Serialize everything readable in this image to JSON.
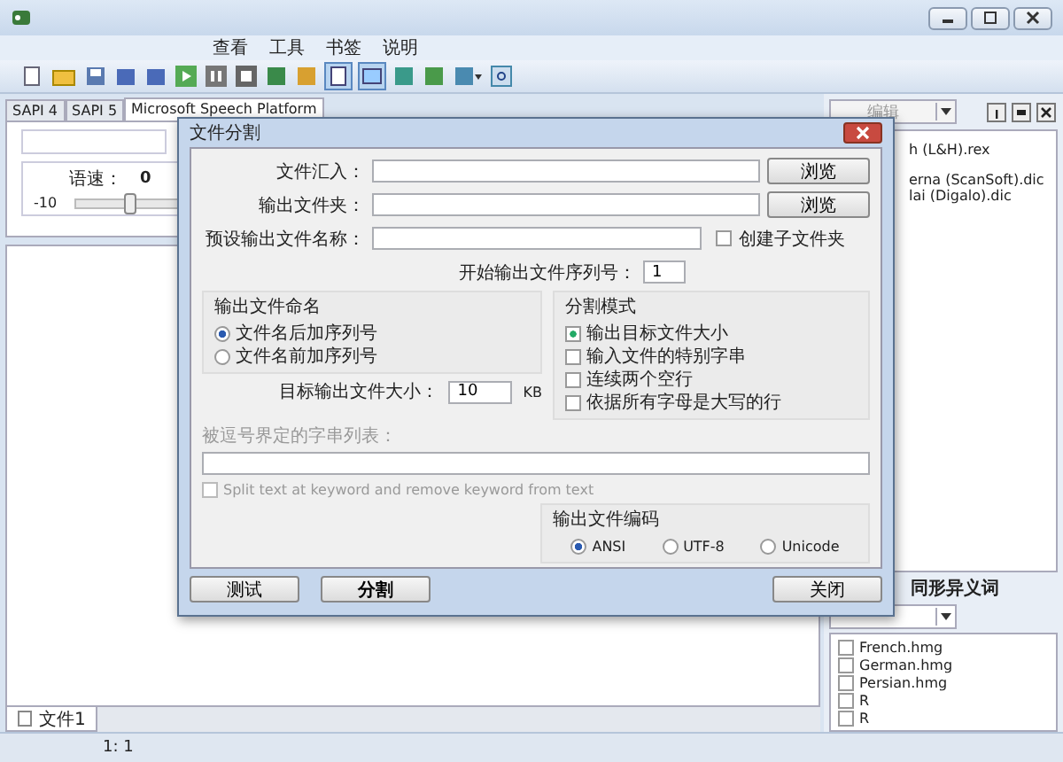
{
  "menu": [
    {
      "label": "查看"
    },
    {
      "label": "工具"
    },
    {
      "label": "书签"
    },
    {
      "label": "说明"
    }
  ],
  "voice_tabs": [
    {
      "label": "SAPI 4",
      "selected": false
    },
    {
      "label": "SAPI 5",
      "selected": false
    },
    {
      "label": "Microsoft Speech Platform",
      "selected": true
    }
  ],
  "rate": {
    "label": "语速：",
    "value": "0",
    "min": "-10",
    "level": 0.5
  },
  "document_tabs": [
    {
      "label": "文件1",
      "selected": true
    }
  ],
  "status_bar": {
    "position": "1:  1"
  },
  "right_panel": {
    "combo": "编辑",
    "dictionaries": [
      "h (L&H).rex",
      "erna (ScanSoft).dic",
      "lai (Digalo).dic"
    ],
    "homograph_title": "同形异义词",
    "homographs": [
      {
        "label": "French.hmg",
        "checked": false
      },
      {
        "label": "German.hmg",
        "checked": false
      },
      {
        "label": "Persian.hmg",
        "checked": false
      },
      {
        "label": "R",
        "checked": false
      },
      {
        "label": "R",
        "checked": false
      }
    ]
  },
  "dialog": {
    "title": "文件分割",
    "fields": [
      {
        "label": "文件汇入：",
        "button": "浏览"
      },
      {
        "label": "输出文件夹：",
        "button": "浏览"
      }
    ],
    "preset_name": {
      "label": "预设输出文件名称：",
      "checkbox": {
        "label": "创建子文件夹",
        "checked": false
      }
    },
    "start_number": {
      "label": "开始输出文件序列号：",
      "value": "1"
    },
    "naming": {
      "title": "输出文件命名",
      "options": [
        {
          "label": "文件名后加序列号",
          "selected": true
        },
        {
          "label": "文件名前加序列号",
          "selected": false
        }
      ]
    },
    "split_mode": {
      "title": "分割模式",
      "options": [
        {
          "label": "输出目标文件大小",
          "checked": true
        },
        {
          "label": "输入文件的特别字串",
          "checked": false
        },
        {
          "label": "连续两个空行",
          "checked": false
        },
        {
          "label": "依据所有字母是大写的行",
          "checked": false
        }
      ]
    },
    "target_size": {
      "label": "目标输出文件大小：",
      "value": "10",
      "unit": "KB"
    },
    "keywords": {
      "label": "被逗号界定的字串列表：",
      "disabled": true
    },
    "keyword_split": {
      "label": "Split text at keyword and remove keyword from text",
      "checked": false,
      "disabled": true
    },
    "encoding": {
      "title": "输出文件编码",
      "options": [
        {
          "label": "ANSI",
          "selected": true
        },
        {
          "label": "UTF-8",
          "selected": false
        },
        {
          "label": "Unicode",
          "selected": false
        }
      ]
    },
    "buttons": [
      {
        "label": "测试",
        "kind": "left",
        "default": false
      },
      {
        "label": "分割",
        "kind": "left",
        "default": true
      },
      {
        "label": "关闭",
        "kind": "right",
        "default": false
      }
    ]
  }
}
